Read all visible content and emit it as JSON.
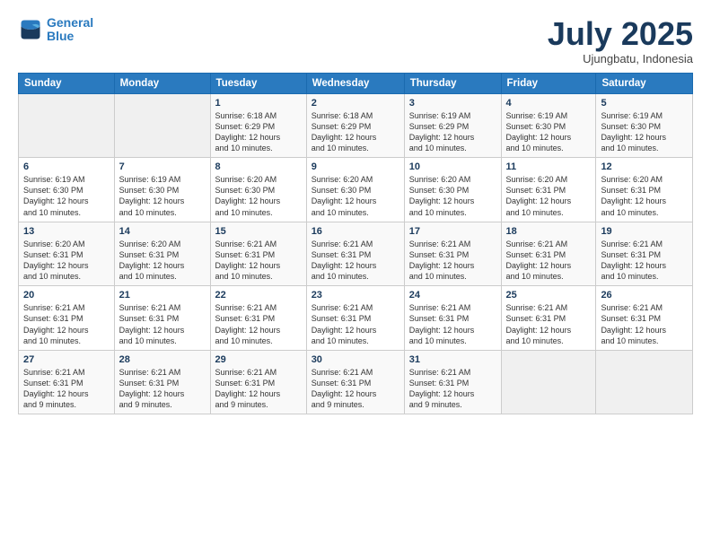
{
  "logo": {
    "line1": "General",
    "line2": "Blue"
  },
  "title": {
    "month": "July 2025",
    "location": "Ujungbatu, Indonesia"
  },
  "weekdays": [
    "Sunday",
    "Monday",
    "Tuesday",
    "Wednesday",
    "Thursday",
    "Friday",
    "Saturday"
  ],
  "weeks": [
    [
      {
        "day": "",
        "info": ""
      },
      {
        "day": "",
        "info": ""
      },
      {
        "day": "1",
        "info": "Sunrise: 6:18 AM\nSunset: 6:29 PM\nDaylight: 12 hours\nand 10 minutes."
      },
      {
        "day": "2",
        "info": "Sunrise: 6:18 AM\nSunset: 6:29 PM\nDaylight: 12 hours\nand 10 minutes."
      },
      {
        "day": "3",
        "info": "Sunrise: 6:19 AM\nSunset: 6:29 PM\nDaylight: 12 hours\nand 10 minutes."
      },
      {
        "day": "4",
        "info": "Sunrise: 6:19 AM\nSunset: 6:30 PM\nDaylight: 12 hours\nand 10 minutes."
      },
      {
        "day": "5",
        "info": "Sunrise: 6:19 AM\nSunset: 6:30 PM\nDaylight: 12 hours\nand 10 minutes."
      }
    ],
    [
      {
        "day": "6",
        "info": "Sunrise: 6:19 AM\nSunset: 6:30 PM\nDaylight: 12 hours\nand 10 minutes."
      },
      {
        "day": "7",
        "info": "Sunrise: 6:19 AM\nSunset: 6:30 PM\nDaylight: 12 hours\nand 10 minutes."
      },
      {
        "day": "8",
        "info": "Sunrise: 6:20 AM\nSunset: 6:30 PM\nDaylight: 12 hours\nand 10 minutes."
      },
      {
        "day": "9",
        "info": "Sunrise: 6:20 AM\nSunset: 6:30 PM\nDaylight: 12 hours\nand 10 minutes."
      },
      {
        "day": "10",
        "info": "Sunrise: 6:20 AM\nSunset: 6:30 PM\nDaylight: 12 hours\nand 10 minutes."
      },
      {
        "day": "11",
        "info": "Sunrise: 6:20 AM\nSunset: 6:31 PM\nDaylight: 12 hours\nand 10 minutes."
      },
      {
        "day": "12",
        "info": "Sunrise: 6:20 AM\nSunset: 6:31 PM\nDaylight: 12 hours\nand 10 minutes."
      }
    ],
    [
      {
        "day": "13",
        "info": "Sunrise: 6:20 AM\nSunset: 6:31 PM\nDaylight: 12 hours\nand 10 minutes."
      },
      {
        "day": "14",
        "info": "Sunrise: 6:20 AM\nSunset: 6:31 PM\nDaylight: 12 hours\nand 10 minutes."
      },
      {
        "day": "15",
        "info": "Sunrise: 6:21 AM\nSunset: 6:31 PM\nDaylight: 12 hours\nand 10 minutes."
      },
      {
        "day": "16",
        "info": "Sunrise: 6:21 AM\nSunset: 6:31 PM\nDaylight: 12 hours\nand 10 minutes."
      },
      {
        "day": "17",
        "info": "Sunrise: 6:21 AM\nSunset: 6:31 PM\nDaylight: 12 hours\nand 10 minutes."
      },
      {
        "day": "18",
        "info": "Sunrise: 6:21 AM\nSunset: 6:31 PM\nDaylight: 12 hours\nand 10 minutes."
      },
      {
        "day": "19",
        "info": "Sunrise: 6:21 AM\nSunset: 6:31 PM\nDaylight: 12 hours\nand 10 minutes."
      }
    ],
    [
      {
        "day": "20",
        "info": "Sunrise: 6:21 AM\nSunset: 6:31 PM\nDaylight: 12 hours\nand 10 minutes."
      },
      {
        "day": "21",
        "info": "Sunrise: 6:21 AM\nSunset: 6:31 PM\nDaylight: 12 hours\nand 10 minutes."
      },
      {
        "day": "22",
        "info": "Sunrise: 6:21 AM\nSunset: 6:31 PM\nDaylight: 12 hours\nand 10 minutes."
      },
      {
        "day": "23",
        "info": "Sunrise: 6:21 AM\nSunset: 6:31 PM\nDaylight: 12 hours\nand 10 minutes."
      },
      {
        "day": "24",
        "info": "Sunrise: 6:21 AM\nSunset: 6:31 PM\nDaylight: 12 hours\nand 10 minutes."
      },
      {
        "day": "25",
        "info": "Sunrise: 6:21 AM\nSunset: 6:31 PM\nDaylight: 12 hours\nand 10 minutes."
      },
      {
        "day": "26",
        "info": "Sunrise: 6:21 AM\nSunset: 6:31 PM\nDaylight: 12 hours\nand 10 minutes."
      }
    ],
    [
      {
        "day": "27",
        "info": "Sunrise: 6:21 AM\nSunset: 6:31 PM\nDaylight: 12 hours\nand 9 minutes."
      },
      {
        "day": "28",
        "info": "Sunrise: 6:21 AM\nSunset: 6:31 PM\nDaylight: 12 hours\nand 9 minutes."
      },
      {
        "day": "29",
        "info": "Sunrise: 6:21 AM\nSunset: 6:31 PM\nDaylight: 12 hours\nand 9 minutes."
      },
      {
        "day": "30",
        "info": "Sunrise: 6:21 AM\nSunset: 6:31 PM\nDaylight: 12 hours\nand 9 minutes."
      },
      {
        "day": "31",
        "info": "Sunrise: 6:21 AM\nSunset: 6:31 PM\nDaylight: 12 hours\nand 9 minutes."
      },
      {
        "day": "",
        "info": ""
      },
      {
        "day": "",
        "info": ""
      }
    ]
  ]
}
